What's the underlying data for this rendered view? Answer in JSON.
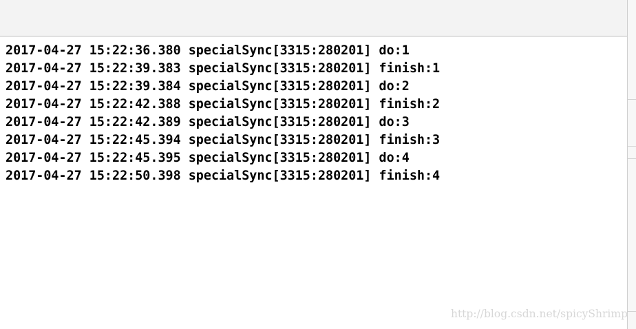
{
  "console": {
    "lines": [
      "2017-04-27 15:22:36.380 specialSync[3315:280201] do:1",
      "2017-04-27 15:22:39.383 specialSync[3315:280201] finish:1",
      "2017-04-27 15:22:39.384 specialSync[3315:280201] do:2",
      "2017-04-27 15:22:42.388 specialSync[3315:280201] finish:2",
      "2017-04-27 15:22:42.389 specialSync[3315:280201] do:3",
      "2017-04-27 15:22:45.394 specialSync[3315:280201] finish:3",
      "2017-04-27 15:22:45.395 specialSync[3315:280201] do:4",
      "2017-04-27 15:22:50.398 specialSync[3315:280201] finish:4"
    ]
  },
  "watermark": "http://blog.csdn.net/spicyShrimp"
}
